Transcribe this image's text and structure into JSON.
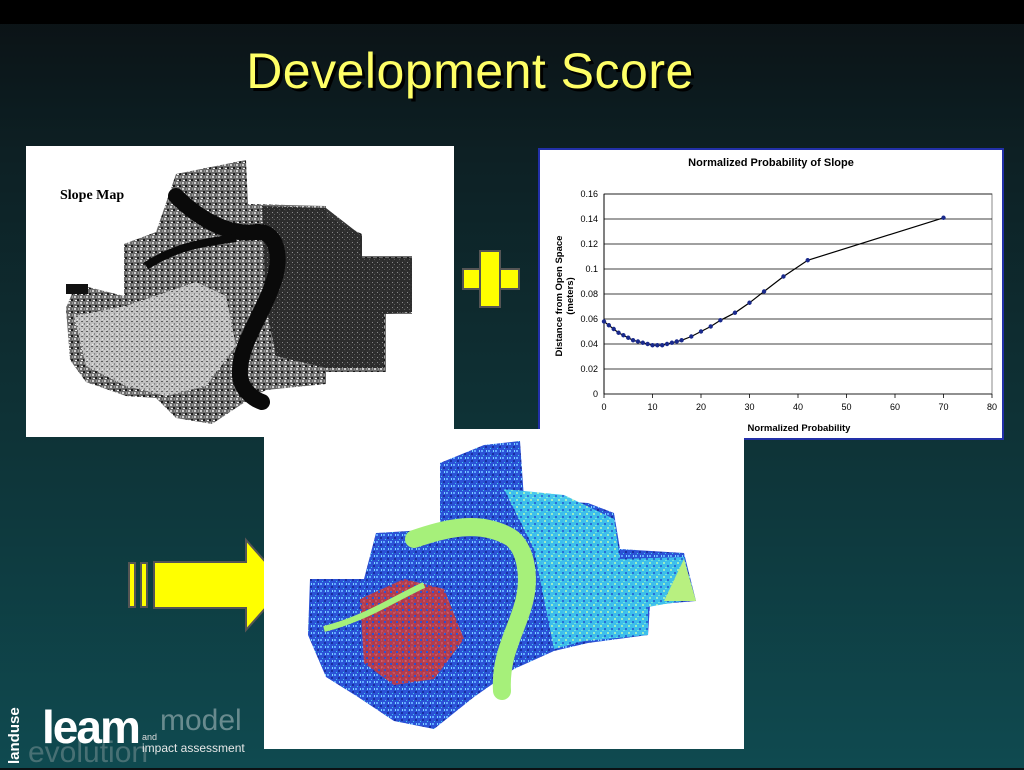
{
  "slide": {
    "title": "Development Score"
  },
  "slope_map": {
    "label": "Slope Map"
  },
  "operators": {
    "plus": "+",
    "equals": "="
  },
  "chart_data": {
    "type": "scatter",
    "title": "Normalized Probability of Slope",
    "xlabel": "Normalized Probability",
    "ylabel": "Distance from Open Space (meters)",
    "ylabel_lines": [
      "Distance from Open Space",
      "(meters)"
    ],
    "xlim": [
      0,
      80
    ],
    "ylim": [
      0,
      0.16
    ],
    "x_ticks": [
      0,
      10,
      20,
      30,
      40,
      50,
      60,
      70,
      80
    ],
    "y_ticks": [
      0,
      0.02,
      0.04,
      0.06,
      0.08,
      0.1,
      0.12,
      0.14,
      0.16
    ],
    "x_tick_labels": [
      "0",
      "10",
      "20",
      "30",
      "40",
      "50",
      "60",
      "70",
      "80"
    ],
    "y_tick_labels": [
      "0",
      "0.02",
      "0.04",
      "0.06",
      "0.08",
      "0.1",
      "0.12",
      "0.14",
      "0.16"
    ],
    "grid": true,
    "series": [
      {
        "marker_color": "#1a2a8c",
        "line_color": "#000000",
        "x": [
          0,
          1,
          2,
          3,
          4,
          5,
          6,
          7,
          8,
          9,
          10,
          11,
          12,
          13,
          14,
          15,
          16,
          18,
          20,
          22,
          24,
          27,
          30,
          33,
          37,
          42,
          70
        ],
        "y": [
          0.058,
          0.055,
          0.052,
          0.049,
          0.047,
          0.045,
          0.043,
          0.042,
          0.041,
          0.04,
          0.039,
          0.039,
          0.039,
          0.04,
          0.041,
          0.042,
          0.043,
          0.046,
          0.05,
          0.054,
          0.059,
          0.065,
          0.073,
          0.082,
          0.094,
          0.107,
          0.141
        ]
      }
    ]
  },
  "logo": {
    "side_text": "landuse",
    "brand": "leam",
    "and": "and",
    "model": "model",
    "impact": "impact assessment",
    "evolution": "evolution"
  },
  "colors": {
    "title": "#ffff66",
    "arrow": "#ffff00",
    "chart_border": "#2230a8"
  }
}
